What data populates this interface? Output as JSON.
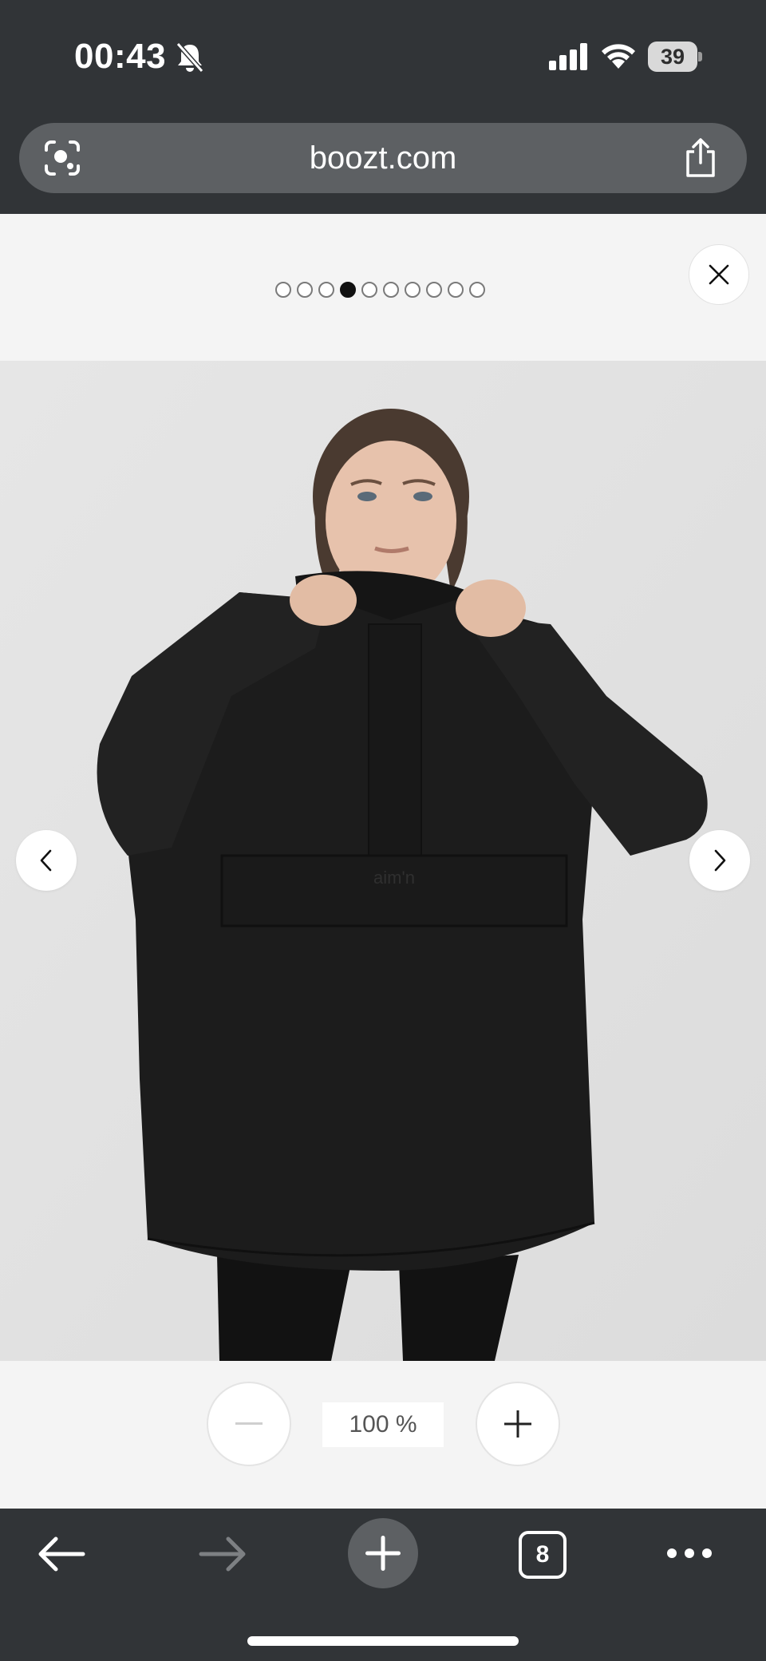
{
  "status_bar": {
    "time": "00:43",
    "battery": "39",
    "icons": [
      "bell-slash-icon",
      "cellular-signal-icon",
      "wifi-icon",
      "battery-icon"
    ]
  },
  "browser": {
    "url": "boozt.com",
    "icons": [
      "visual-search-icon",
      "share-icon"
    ]
  },
  "gallery": {
    "dot_count": 10,
    "active_index": 3,
    "close_icon": "close-icon",
    "prev_icon": "chevron-left-icon",
    "next_icon": "chevron-right-icon",
    "image_alt": "Model wearing black oversized anorak",
    "jacket_logo": "aim'n"
  },
  "zoom": {
    "level": "100 %",
    "zoom_out_icon": "minus-icon",
    "zoom_in_icon": "plus-icon"
  },
  "bottom_bar": {
    "tab_count": "8",
    "icons": [
      "back-arrow-icon",
      "forward-arrow-icon",
      "new-tab-plus-icon",
      "tabs-icon",
      "more-icon"
    ]
  }
}
